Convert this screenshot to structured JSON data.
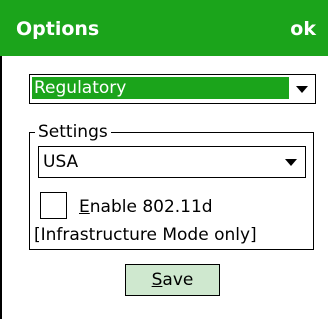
{
  "header": {
    "title": "Options",
    "ok_label": "ok"
  },
  "mode_dropdown": {
    "value": "Regulatory",
    "icon": "chevron-down-icon"
  },
  "settings": {
    "group_label": "Settings",
    "country_dropdown": {
      "value": "USA",
      "icon": "chevron-down-icon"
    },
    "enable_80211d": {
      "label": "Enable 802.11d",
      "checked": false
    },
    "note": "[Infrastructure Mode only]"
  },
  "save_label": "Save",
  "colors": {
    "accent": "#1ba41b",
    "button_background": "#cfe8cf"
  }
}
